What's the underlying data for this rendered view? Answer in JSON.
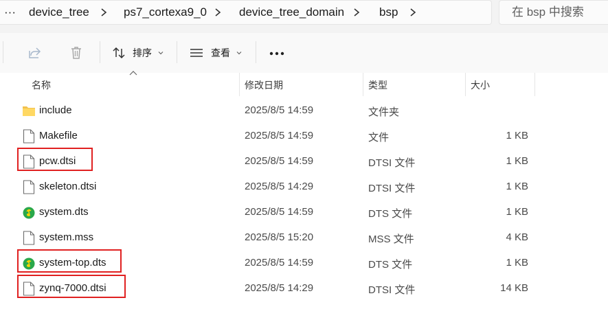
{
  "breadcrumb": {
    "overflow": "···",
    "items": [
      "device_tree",
      "ps7_cortexa9_0",
      "device_tree_domain",
      "bsp"
    ]
  },
  "search": {
    "placeholder": "在 bsp 中搜索"
  },
  "toolbar": {
    "sort_label": "排序",
    "view_label": "查看",
    "more_label": "···"
  },
  "columns": {
    "name": "名称",
    "modified": "修改日期",
    "type": "类型",
    "size": "大小"
  },
  "files": [
    {
      "name": "include",
      "modified": "2025/8/5 14:59",
      "type": "文件夹",
      "size": "",
      "icon": "folder-icon",
      "highlighted": false
    },
    {
      "name": "Makefile",
      "modified": "2025/8/5 14:59",
      "type": "文件",
      "size": "1 KB",
      "icon": "file-icon",
      "highlighted": false
    },
    {
      "name": "pcw.dtsi",
      "modified": "2025/8/5 14:59",
      "type": "DTSI 文件",
      "size": "1 KB",
      "icon": "file-icon",
      "highlighted": true
    },
    {
      "name": "skeleton.dtsi",
      "modified": "2025/8/5 14:29",
      "type": "DTSI 文件",
      "size": "1 KB",
      "icon": "file-icon",
      "highlighted": false
    },
    {
      "name": "system.dts",
      "modified": "2025/8/5 14:59",
      "type": "DTS 文件",
      "size": "1 KB",
      "icon": "music-app-icon",
      "highlighted": false
    },
    {
      "name": "system.mss",
      "modified": "2025/8/5 15:20",
      "type": "MSS 文件",
      "size": "4 KB",
      "icon": "file-icon",
      "highlighted": false
    },
    {
      "name": "system-top.dts",
      "modified": "2025/8/5 14:59",
      "type": "DTS 文件",
      "size": "1 KB",
      "icon": "music-app-icon",
      "highlighted": true
    },
    {
      "name": "zynq-7000.dtsi",
      "modified": "2025/8/5 14:29",
      "type": "DTSI 文件",
      "size": "14 KB",
      "icon": "file-icon",
      "highlighted": true
    }
  ],
  "colors": {
    "highlight": "#e02020",
    "folder": "#f2c14e",
    "music_app": "#2aa84a"
  }
}
